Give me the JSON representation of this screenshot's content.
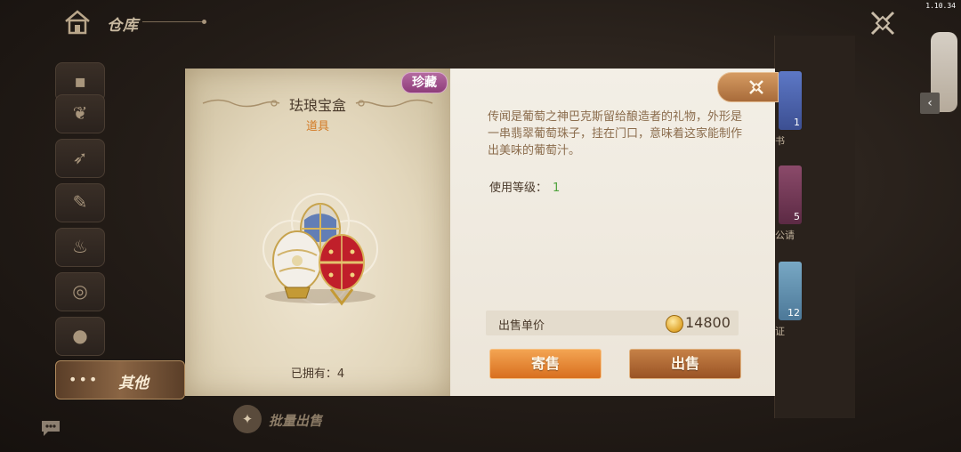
{
  "version": "1.10.34",
  "header": {
    "title": "仓库",
    "home_icon": "home-icon",
    "close_icon": "close-icon"
  },
  "sidebar": {
    "categories": [
      {
        "icon": "bag-icon"
      },
      {
        "icon": "feather-icon"
      },
      {
        "icon": "bow-icon"
      },
      {
        "icon": "tool-icon"
      },
      {
        "icon": "pot-icon"
      },
      {
        "icon": "spiral-icon"
      },
      {
        "icon": "bottle-icon"
      }
    ],
    "active_label": "其他"
  },
  "inventory_partial": {
    "slots": [
      {
        "count": "1",
        "label_fragment": "书",
        "color": "#4a66b8"
      },
      {
        "count": "5",
        "label_fragment": "公请",
        "color": "#7a3a5a"
      },
      {
        "count": "12",
        "label_fragment": "证",
        "color": "#5a8aa8"
      }
    ]
  },
  "bulk_sell": {
    "label": "批量出售"
  },
  "modal": {
    "rarity": "珍藏",
    "rarity_color": "#9a4a88",
    "item_name": "珐琅宝盒",
    "item_type": "道具",
    "owned_label": "已拥有：",
    "owned_count": "4",
    "description": "传闻是葡萄之神巴克斯留给酿造者的礼物，外形是一串翡翠葡萄珠子，挂在门口，意味着这家能制作出美味的葡萄汁。",
    "level_label": "使用等级：",
    "level_value": "1",
    "price_label": "出售单价",
    "price_value": "14800",
    "consign_button": "寄售",
    "sell_button": "出售"
  }
}
